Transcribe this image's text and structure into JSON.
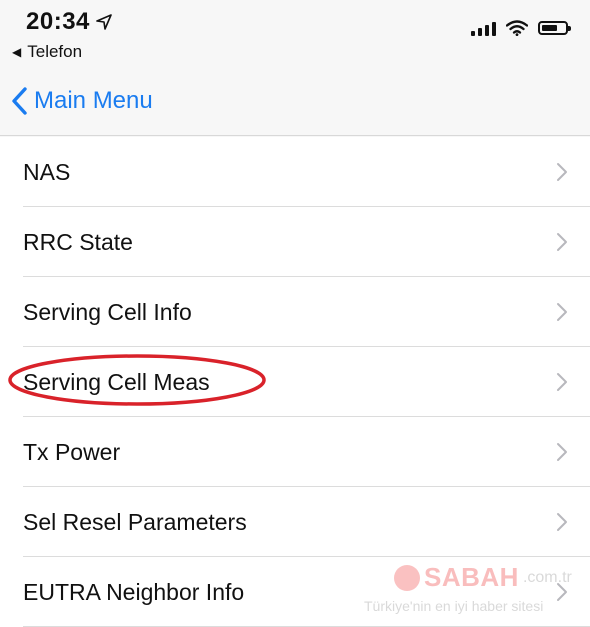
{
  "status_bar": {
    "time": "20:34",
    "back_app": "Telefon",
    "icons": [
      "location-arrow-icon",
      "signal-icon",
      "wifi-icon",
      "battery-icon"
    ],
    "battery_level": 0.7
  },
  "nav": {
    "back_label": "Main Menu",
    "accent_color": "#1a7cf0"
  },
  "menu": {
    "items": [
      {
        "label": "NAS"
      },
      {
        "label": "RRC State"
      },
      {
        "label": "Serving Cell Info"
      },
      {
        "label": "Serving Cell Meas"
      },
      {
        "label": "Tx Power"
      },
      {
        "label": "Sel Resel Parameters"
      },
      {
        "label": "EUTRA Neighbor Info"
      }
    ],
    "highlighted_item": "Serving Cell Meas",
    "highlight_color": "#d9222a"
  },
  "watermark": {
    "brand": "SABAH",
    "domain": ".com.tr",
    "slogan": "Türkiye'nin en iyi haber sitesi"
  }
}
